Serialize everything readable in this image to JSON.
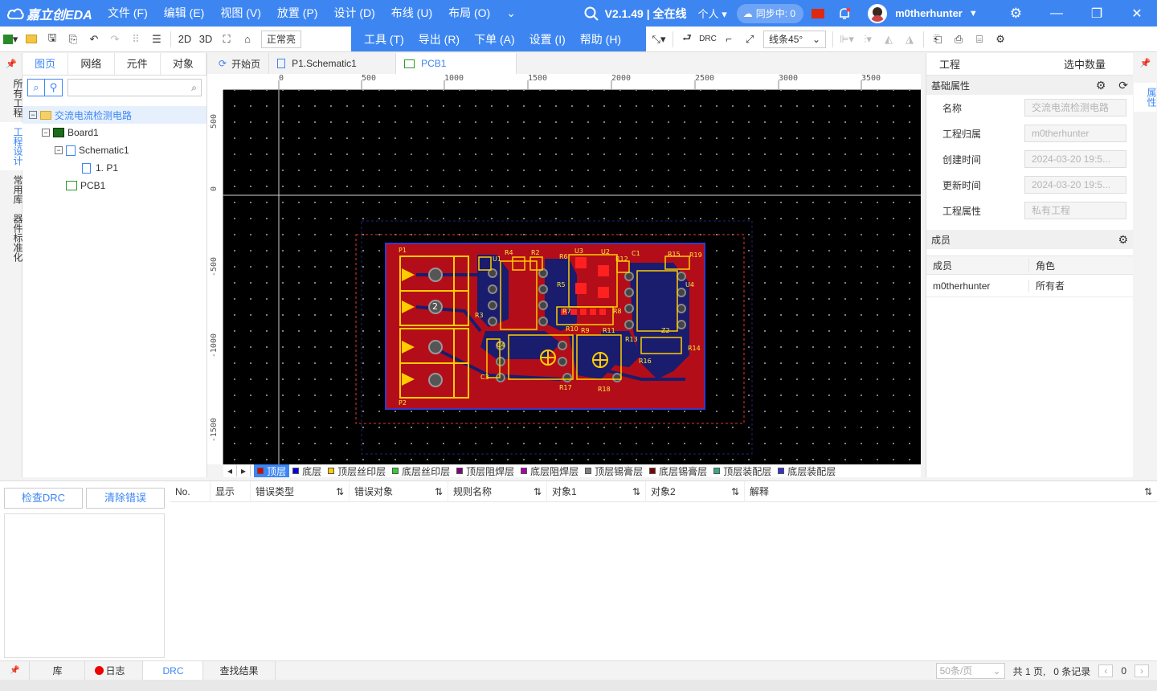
{
  "app": {
    "logo_text": "嘉立创EDA",
    "menus": [
      "文件 (F)",
      "编辑 (E)",
      "视图 (V)",
      "放置 (P)",
      "设计 (D)",
      "布线 (U)",
      "布局 (O)"
    ],
    "more_menu_icon": "chevron-down-icon",
    "version": "V2.1.49 | 全在线",
    "workspace": "个人",
    "sync_status": "同步中: 0",
    "username": "m0therhunter",
    "accent_color": "#3d86f2"
  },
  "dropdown_menu": {
    "items": [
      "工具 (T)",
      "导出 (R)",
      "下单 (A)",
      "设置 (I)",
      "帮助 (H)"
    ]
  },
  "toolbar": {
    "view_2d": "2D",
    "view_3d": "3D",
    "display_mode": "正常亮",
    "drc_label": "DRC",
    "line_mode": "线条45°"
  },
  "left_vtabs": [
    "所有工程",
    "工程设计",
    "常用库",
    "器件标准化"
  ],
  "left_panel": {
    "tabs": [
      "图页",
      "网络",
      "元件",
      "对象"
    ],
    "active_tab": "图页",
    "tree": [
      {
        "label": "交流电流检测电路",
        "level": 0,
        "type": "folder",
        "selected": true
      },
      {
        "label": "Board1",
        "level": 1,
        "type": "board"
      },
      {
        "label": "Schematic1",
        "level": 2,
        "type": "schematic"
      },
      {
        "label": "1. P1",
        "level": 3,
        "type": "page"
      },
      {
        "label": "PCB1",
        "level": 2,
        "type": "pcb"
      }
    ]
  },
  "editor_tabs": [
    {
      "label": "开始页",
      "icon": "home-icon"
    },
    {
      "label": "P1.Schematic1",
      "icon": "document-icon"
    },
    {
      "label": "PCB1",
      "icon": "pcb-icon",
      "active": true
    }
  ],
  "ruler": {
    "top_ticks": [
      "0",
      "500",
      "1000",
      "1500",
      "2000",
      "2500",
      "3000",
      "3500"
    ],
    "left_ticks": [
      "500",
      "0",
      "-500",
      "-1000",
      "-1500"
    ]
  },
  "pcb_labels": [
    "P1",
    "P2",
    "R4",
    "R2",
    "R6",
    "U3",
    "U2",
    "R12",
    "C1",
    "R15",
    "R19",
    "U1",
    "U4",
    "R5",
    "R7",
    "R8",
    "R10",
    "R9",
    "R11",
    "R3",
    "R13",
    "R14",
    "R16",
    "C4",
    "C3",
    "R17",
    "R18",
    "2"
  ],
  "layers": [
    {
      "name": "顶层",
      "color": "#e00000",
      "active": true
    },
    {
      "name": "底层",
      "color": "#0000e0"
    },
    {
      "name": "顶层丝印层",
      "color": "#ffcc00"
    },
    {
      "name": "底层丝印层",
      "color": "#33cc33"
    },
    {
      "name": "顶层阻焊层",
      "color": "#800080"
    },
    {
      "name": "底层阻焊层",
      "color": "#aa00aa"
    },
    {
      "name": "顶层锡膏层",
      "color": "#808080"
    },
    {
      "name": "底层锡膏层",
      "color": "#800000"
    },
    {
      "name": "顶层装配层",
      "color": "#33aa88"
    },
    {
      "name": "底层装配层",
      "color": "#3333cc"
    }
  ],
  "right_panel": {
    "tab_project": "工程",
    "tab_selected": "选中数量",
    "section_basic": "基础属性",
    "properties": [
      {
        "label": "名称",
        "value": "交流电流检测电路"
      },
      {
        "label": "工程归属",
        "value": "m0therhunter"
      },
      {
        "label": "创建时间",
        "value": "2024-03-20 19:5..."
      },
      {
        "label": "更新时间",
        "value": "2024-03-20 19:5..."
      },
      {
        "label": "工程属性",
        "value": "私有工程"
      }
    ],
    "section_members": "成员",
    "members_cols": [
      "成员",
      "角色"
    ],
    "members": [
      {
        "name": "m0therhunter",
        "role": "所有者"
      }
    ],
    "vtab": "属性"
  },
  "drc": {
    "check_button": "检查DRC",
    "clear_button": "清除错误",
    "columns": [
      "No.",
      "显示",
      "错误类型",
      "错误对象",
      "规则名称",
      "对象1",
      "对象2",
      "解释"
    ]
  },
  "bottom_tabs": [
    {
      "label": "库"
    },
    {
      "label": "日志",
      "dot": true
    },
    {
      "label": "DRC",
      "active": true
    },
    {
      "label": "查找结果"
    }
  ],
  "pager": {
    "per_page": "50条/页",
    "pages": "共 1 页,",
    "records": "0 条记录",
    "current": "0"
  }
}
